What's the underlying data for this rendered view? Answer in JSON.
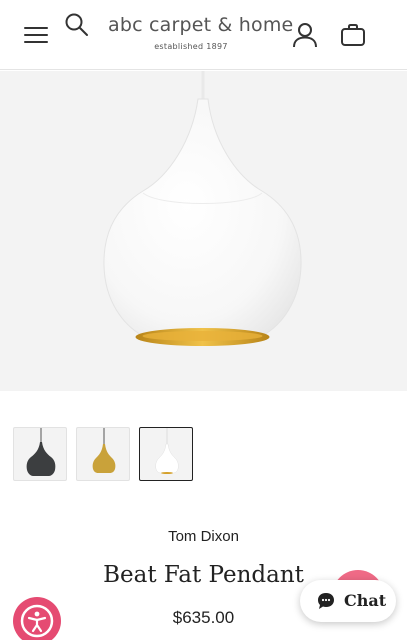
{
  "header": {
    "logo_text": "abc carpet & home",
    "logo_tagline": "established 1897",
    "menu_icon": "hamburger-icon",
    "search_icon": "search-icon",
    "account_icon": "user-icon",
    "cart_icon": "bag-icon"
  },
  "gallery": {
    "thumbnails": [
      {
        "color": "black"
      },
      {
        "color": "brass"
      },
      {
        "color": "white",
        "selected": true
      }
    ]
  },
  "product": {
    "brand": "Tom Dixon",
    "title": "Beat Fat Pendant",
    "price": "$635.00"
  },
  "widgets": {
    "accessibility_icon": "accessibility-icon",
    "chat_label": "Chat",
    "chat_icon": "chat-bubble-icon"
  },
  "colors": {
    "accent_pink": "#e54b72",
    "hero_bg": "#f3f3f3",
    "gold": "#d4a02a"
  }
}
